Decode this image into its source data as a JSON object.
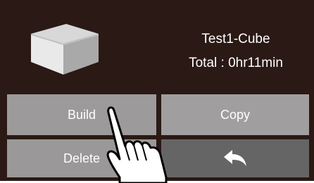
{
  "file": {
    "name": "Test1-Cube",
    "total_time": "Total : 0hr11min"
  },
  "buttons": {
    "build": "Build",
    "copy": "Copy",
    "delete": "Delete",
    "back_icon": "back-arrow-icon"
  },
  "colors": {
    "background": "#2a1915",
    "button": "#9c9a9a",
    "button_dark": "#666565",
    "text": "#ffffff"
  }
}
